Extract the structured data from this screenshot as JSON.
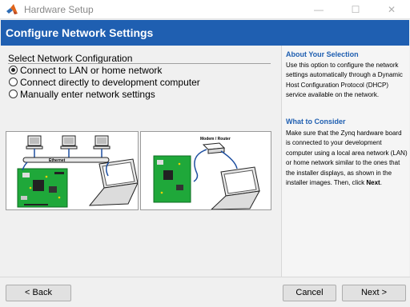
{
  "window": {
    "title": "Hardware Setup",
    "minimize": "—",
    "maximize": "☐",
    "close": "✕"
  },
  "header": {
    "title": "Configure Network Settings"
  },
  "selection": {
    "label": "Select Network Configuration",
    "options": [
      {
        "label": "Connect to LAN or home network",
        "checked": true
      },
      {
        "label": "Connect directly to development computer",
        "checked": false
      },
      {
        "label": "Manually enter network settings",
        "checked": false
      }
    ]
  },
  "images": {
    "lan_label": "Ethernet",
    "direct_label": "Modem / Router"
  },
  "side": {
    "about_heading": "About Your Selection",
    "about_text": "Use this option to configure the network settings automatically through a Dynamic Host Configuration Protocol (DHCP) service available on the network.",
    "consider_heading": "What to Consider",
    "consider_text": "Make sure that the Zynq hardware board is connected to your development computer using a local area network (LAN) or home network similar to the ones that the installer displays, as shown in the installer images. Then, click",
    "consider_bold": "Next",
    "consider_end": "."
  },
  "footer": {
    "back": "< Back",
    "cancel": "Cancel",
    "next": "Next >"
  },
  "colors": {
    "header_blue": "#1f5fb1",
    "board_green": "#1fa83a"
  }
}
